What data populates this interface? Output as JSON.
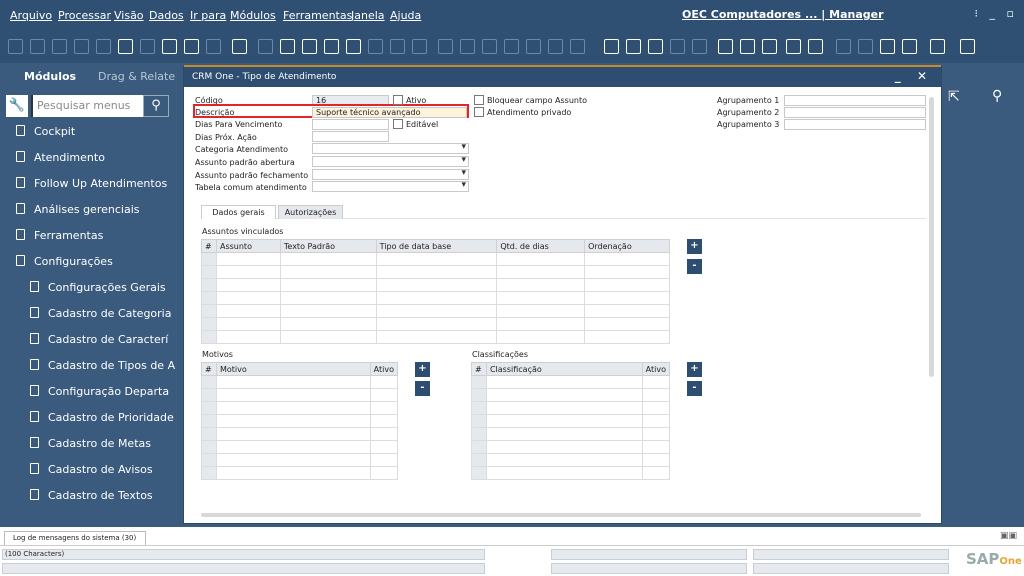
{
  "menu": [
    "Arquivo",
    "Processar",
    "Visão",
    "Dados",
    "Ir para",
    "Módulos",
    "Ferramentas",
    "Janela",
    "Ajuda"
  ],
  "company": "OEC Computadores ... | Manager",
  "sidebar": {
    "tabs": [
      "Módulos",
      "Drag & Relate"
    ],
    "search_placeholder": "Pesquisar menus",
    "items": [
      "Cockpit",
      "Atendimento",
      "Follow Up Atendimentos",
      "Análises gerenciais",
      "Ferramentas",
      "Configurações"
    ],
    "subitems": [
      "Configurações Gerais",
      "Cadastro de Categoria",
      "Cadastro de Caracterí",
      "Cadastro de Tipos de A",
      "Configuração Departa",
      "Cadastro de Prioridade",
      "Cadastro de Metas",
      "Cadastro de Avisos",
      "Cadastro de Textos"
    ]
  },
  "window": {
    "title": "CRM One - Tipo de Atendimento",
    "fields": {
      "codigo_label": "Código",
      "codigo_value": "16",
      "descricao_label": "Descrição",
      "descricao_value": "Suporte técnico avançado",
      "dias_venc_label": "Dias Para Vencimento",
      "dias_prox_label": "Dias Próx. Ação",
      "categoria_label": "Categoria Atendimento",
      "assunto_abertura_label": "Assunto padrão abertura",
      "assunto_fechamento_label": "Assunto padrão fechamento",
      "tabela_label": "Tabela comum atendimento"
    },
    "checkboxes": {
      "ativo": "Ativo",
      "editavel": "Editável",
      "bloquear": "Bloquear campo Assunto",
      "privado": "Atendimento privado"
    },
    "agrupamentos": [
      "Agrupamento 1",
      "Agrupamento 2",
      "Agrupamento 3"
    ],
    "tabs": [
      "Dados gerais",
      "Autorizações"
    ],
    "assuntos": {
      "title": "Assuntos vinculados",
      "columns": [
        "#",
        "Assunto",
        "Texto Padrão",
        "Tipo de data base",
        "Qtd. de dias",
        "Ordenação"
      ]
    },
    "motivos": {
      "title": "Motivos",
      "columns": [
        "#",
        "Motivo",
        "Ativo"
      ]
    },
    "classificacoes": {
      "title": "Classificações",
      "columns": [
        "#",
        "Classificação",
        "Ativo"
      ]
    },
    "add": "+",
    "remove": "-"
  },
  "bottom": {
    "log_tab": "Log de mensagens do sistema (30)",
    "status": "(100 Characters)",
    "logo": "SAP Business One"
  }
}
